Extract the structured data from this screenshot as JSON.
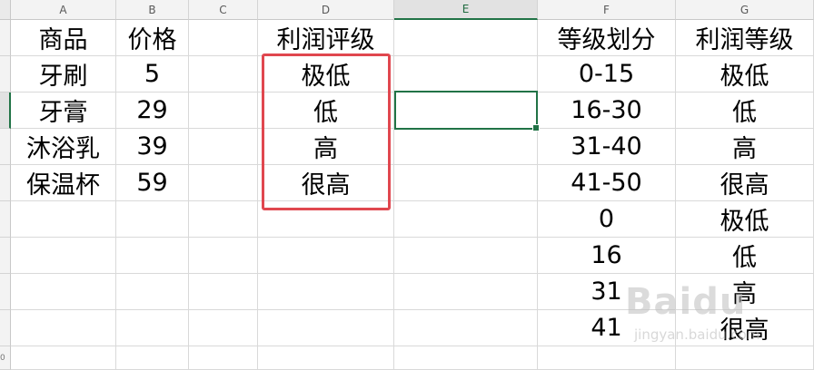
{
  "columns": [
    "A",
    "B",
    "C",
    "D",
    "E",
    "F",
    "G"
  ],
  "row_gutter_visible": [
    "0"
  ],
  "cells": {
    "A1": "商品",
    "B1": "价格",
    "D1": "利润评级",
    "F1": "等级划分",
    "G1": "利润等级",
    "A2": "牙刷",
    "B2": "5",
    "D2": "极低",
    "F2": "0-15",
    "G2": "极低",
    "A3": "牙膏",
    "B3": "29",
    "D3": "低",
    "F3": "16-30",
    "G3": "低",
    "A4": "沐浴乳",
    "B4": "39",
    "D4": "高",
    "F4": "31-40",
    "G4": "高",
    "A5": "保温杯",
    "B5": "59",
    "D5": "很高",
    "F5": "41-50",
    "G5": "很高",
    "F6": "0",
    "G6": "极低",
    "F7": "16",
    "G7": "低",
    "F8": "31",
    "G8": "高",
    "F9": "41",
    "G9": "很高"
  },
  "selected_cell": "E3",
  "highlight_color": "#e0474f",
  "selection_color": "#217346",
  "watermark": {
    "logo": "Baidu",
    "sub": "jingyan.baidu.com"
  }
}
